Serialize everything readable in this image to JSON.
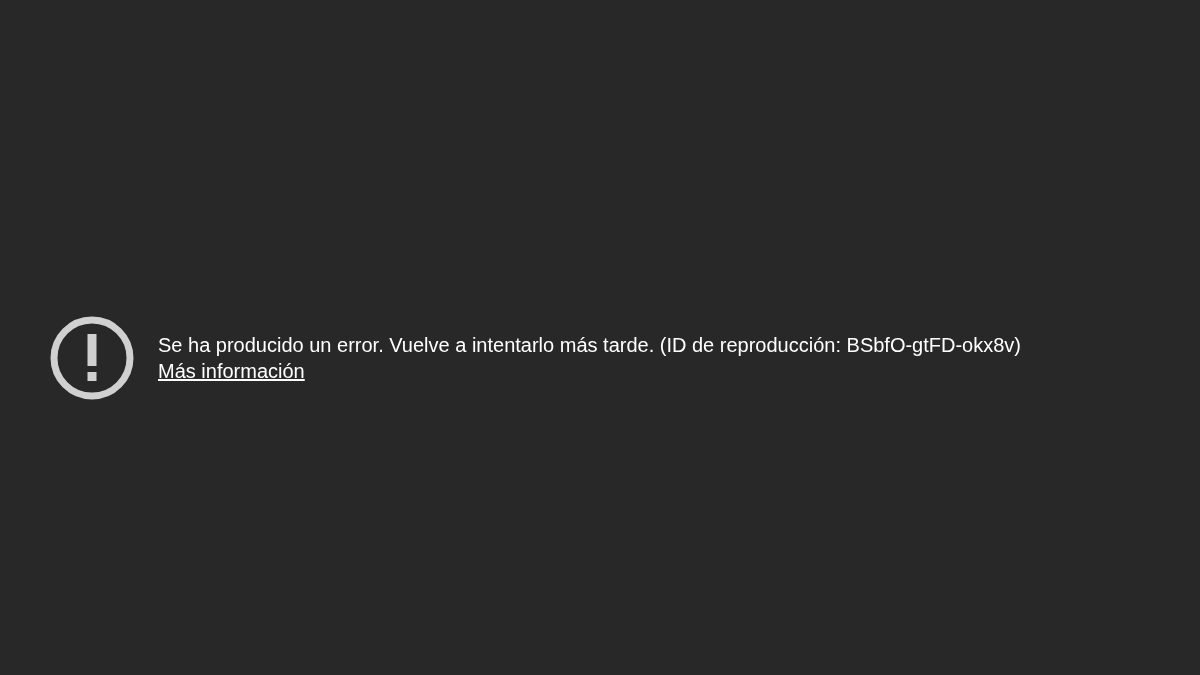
{
  "error": {
    "message": "Se ha producido un error. Vuelve a intentarlo más tarde. (ID de reproducción: BSbfO-gtFD-okx8v)",
    "link": "Más información"
  }
}
